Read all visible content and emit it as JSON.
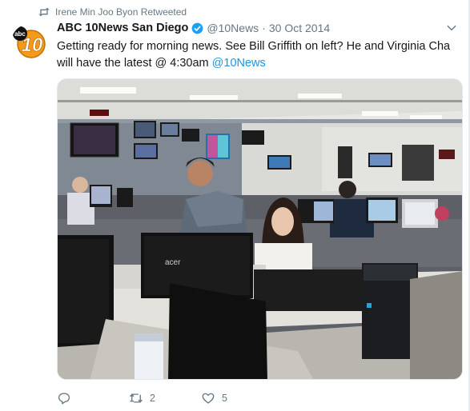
{
  "retweet": {
    "label": "Irene Min Joo Byon Retweeted"
  },
  "author": {
    "name": "ABC 10News San Diego",
    "handle": "@10News",
    "separator": "·",
    "date": "30 Oct 2014",
    "avatar_text": "abc",
    "avatar_number": "10"
  },
  "tweet": {
    "text": "Getting ready for morning news. See Bill Griffith on left? He and Virginia Cha will have the latest @ 4:30am ",
    "mention": "@10News"
  },
  "photo": {
    "monitor_brand": "acer"
  },
  "actions": {
    "reply_count": "",
    "retweet_count": "2",
    "like_count": "5"
  },
  "colors": {
    "link": "#1b95e0",
    "secondary_text": "#657786",
    "verified": "#1da1f2",
    "avatar_orange": "#f39a1b"
  },
  "icons": {
    "retweet": "retweet-icon",
    "reply": "reply-icon",
    "like": "heart-icon",
    "verified": "verified-badge-icon",
    "menu": "chevron-down-icon"
  }
}
